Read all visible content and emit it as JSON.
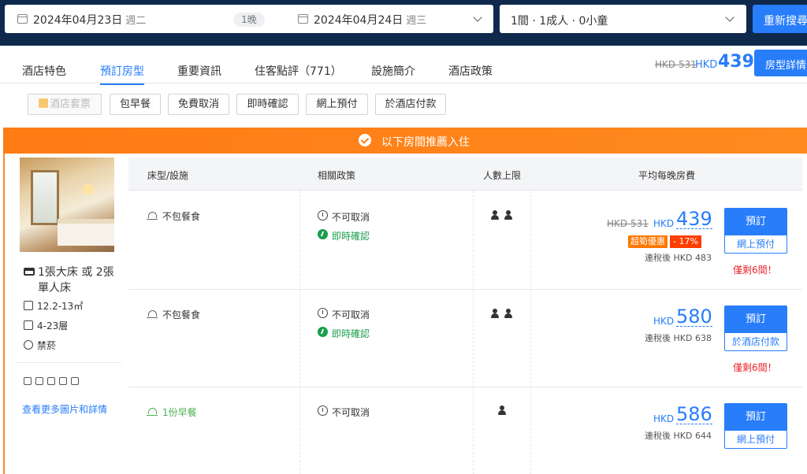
{
  "search": {
    "checkin_date": "2024年04月23日",
    "checkin_weekday": "週二",
    "nights": "1晚",
    "checkout_date": "2024年04月24日",
    "checkout_weekday": "週三",
    "guests": "1間 · 1成人 · 0小童",
    "search_button": "重新搜尋"
  },
  "nav": {
    "tabs": [
      "酒店特色",
      "預訂房型",
      "重要資訊",
      "住客點評（771）",
      "設施簡介",
      "酒店政策"
    ],
    "active_tab": "預訂房型",
    "old_price": "HKD 531",
    "currency": "HKD",
    "price": "439",
    "room_details_button": "房型詳情"
  },
  "filters": [
    "酒店套票",
    "包早餐",
    "免費取消",
    "即時確認",
    "網上預付",
    "於酒店付款"
  ],
  "banner": {
    "text": "以下房間推薦入住"
  },
  "room": {
    "bed": "1張大床 或 2張單人床",
    "size": "12.2-13㎡",
    "floor": "4-23層",
    "smoking": "禁菸",
    "more_link": "查看更多圖片和詳情"
  },
  "table": {
    "headers": [
      "床型/設施",
      "相關政策",
      "人數上限",
      "平均每晚房費"
    ],
    "rows": [
      {
        "meal": "不包餐食",
        "policy_cancel": "不可取消",
        "policy_confirm": "即時確認",
        "guests": 2,
        "old_price": "HKD 531",
        "currency": "HKD",
        "price": "439",
        "promo_label": "超筍優惠",
        "promo_discount": "- 17%",
        "tax_note": "連稅後 HKD 483",
        "book_label": "預訂",
        "payment": "網上預付",
        "rooms_left": "僅剩6間！"
      },
      {
        "meal": "不包餐食",
        "policy_cancel": "不可取消",
        "policy_confirm": "即時確認",
        "guests": 2,
        "currency": "HKD",
        "price": "580",
        "tax_note": "連稅後 HKD 638",
        "book_label": "預訂",
        "payment": "於酒店付款",
        "rooms_left": "僅剩6間！"
      },
      {
        "meal": "1份早餐",
        "policy_cancel": "不可取消",
        "guests": 1,
        "currency": "HKD",
        "price": "586",
        "tax_note": "連稅後 HKD 644",
        "book_label": "預訂",
        "payment": "網上預付"
      }
    ]
  },
  "colors": {
    "brand": "#287dfa",
    "nav_bg": "#0f294d",
    "banner": "#ff8a1e",
    "alert": "#e8262b",
    "confirm": "#1a9e4c"
  }
}
